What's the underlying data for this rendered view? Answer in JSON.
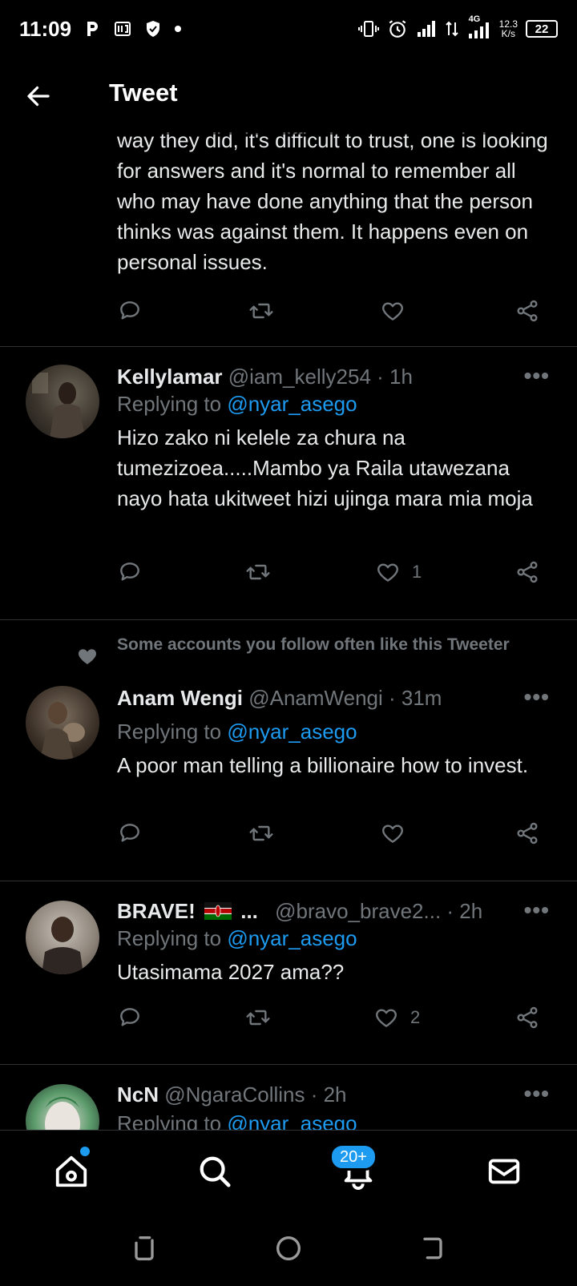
{
  "status_bar": {
    "time": "11:09",
    "network": "4G",
    "speed_value": "12.3",
    "speed_unit": "K/s",
    "battery": "22"
  },
  "header": {
    "title": "Tweet"
  },
  "top_tweet": {
    "text": "way they did, it's difficult to trust, one is looking for answers and it's normal to remember all who may have done anything that the person thinks was against them. It happens even on personal issues.",
    "likes": ""
  },
  "replies": [
    {
      "name": "Kellylamar",
      "handle": "@iam_kelly254",
      "time": "· 1h",
      "replying_label": "Replying to",
      "replying_to": "@nyar_asego",
      "text": "Hizo zako ni kelele za chura na tumezizoea.....Mambo ya Raila utawezana nayo hata ukitweet hizi ujinga mara mia moja",
      "likes": "1"
    },
    {
      "social_context": "Some accounts you follow often like this Tweeter",
      "name": "Anam Wengi",
      "handle": "@AnamWengi",
      "time": "· 31m",
      "replying_label": "Replying to",
      "replying_to": "@nyar_asego",
      "text": "A poor man telling a billionaire how to invest.",
      "likes": ""
    },
    {
      "name": "BRAVE!",
      "name_suffix": "...",
      "handle": "@bravo_brave2...",
      "time": "· 2h",
      "replying_label": "Replying to",
      "replying_to": "@nyar_asego",
      "text": "Utasimama 2027 ama??",
      "likes": "2"
    },
    {
      "name": "NcN",
      "handle": "@NgaraCollins",
      "time": "· 2h",
      "replying_label": "Replying to",
      "replying_to": "@nyar_asego"
    }
  ],
  "more_label": "•••",
  "bottom_nav": {
    "items": [
      "home-icon",
      "search-icon",
      "notifications-icon",
      "messages-icon"
    ],
    "notifications_badge": "20+"
  },
  "colors": {
    "background": "#000000",
    "accent": "#1d9bf0",
    "text": "#e7e9ea",
    "muted": "#71767b",
    "divider": "#2f3336"
  }
}
